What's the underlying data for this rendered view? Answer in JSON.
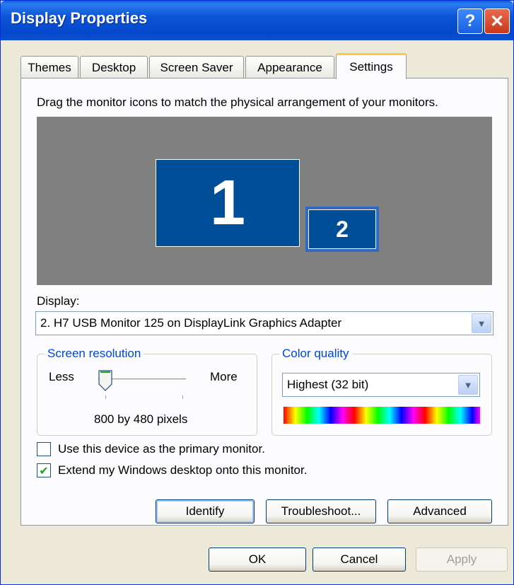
{
  "window": {
    "title": "Display Properties",
    "help_label": "?",
    "close_label": "✕"
  },
  "tabs": [
    {
      "label": "Themes"
    },
    {
      "label": "Desktop"
    },
    {
      "label": "Screen Saver"
    },
    {
      "label": "Appearance"
    },
    {
      "label": "Settings",
      "active": true
    }
  ],
  "settings": {
    "instruction": "Drag the monitor icons to match the physical arrangement of your monitors.",
    "monitors": [
      {
        "number": "1"
      },
      {
        "number": "2",
        "selected": true
      }
    ],
    "display_label": "Display:",
    "display_value": "2. H7 USB Monitor 125 on DisplayLink Graphics Adapter",
    "screen_resolution": {
      "title": "Screen resolution",
      "less_label": "Less",
      "more_label": "More",
      "value_text": "800 by 480 pixels",
      "slider_level": 0
    },
    "color_quality": {
      "title": "Color quality",
      "value": "Highest (32 bit)"
    },
    "primary_checkbox": {
      "label": "Use this device as the primary monitor.",
      "checked": false
    },
    "extend_checkbox": {
      "label": "Extend my Windows desktop onto this monitor.",
      "checked": true
    },
    "buttons": {
      "identify": "Identify",
      "troubleshoot": "Troubleshoot...",
      "advanced": "Advanced"
    }
  },
  "dialog_buttons": {
    "ok": "OK",
    "cancel": "Cancel",
    "apply": "Apply"
  },
  "colors": {
    "titlebar": "#0548cc",
    "monitor_fill": "#004e98",
    "preview_bg": "#808080",
    "group_title": "#0046d5"
  },
  "icons": {
    "dropdown": "chevron-down-icon",
    "checkmark": "checkmark-icon",
    "slider": "slider-thumb-icon"
  }
}
